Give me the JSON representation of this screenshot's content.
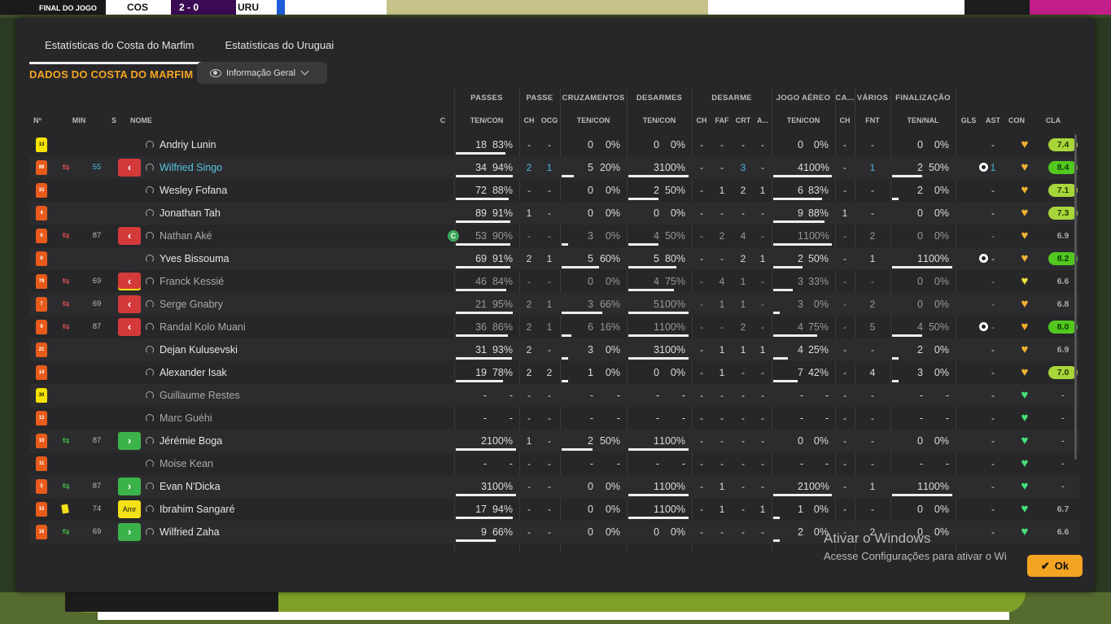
{
  "background": {
    "final_label": "FINAL DO JOGO",
    "team_a": "COS",
    "score": "2 - 0",
    "team_b": "URU"
  },
  "tabs": [
    {
      "label": "Estatísticas do Costa do Marfim",
      "active": true
    },
    {
      "label": "Estatísticas do Uruguai",
      "active": false
    }
  ],
  "section_title": "DADOS DO COSTA DO MARFIM",
  "view_dropdown": {
    "label": "Informação Geral"
  },
  "group_headers": [
    "PASSES",
    "PASSE",
    "CRUZAMENTOS",
    "DESARMES",
    "DESARME",
    "JOGO AÉREO",
    "CA...",
    "VÁRIOS",
    "FINALIZAÇÃO"
  ],
  "columns": {
    "no": "Nº",
    "min": "MIN",
    "s": "S",
    "name": "NOME",
    "c": "C",
    "passes": "TEN/CON",
    "passe_ch": "CH",
    "passe_ocg": "OCG",
    "cruz": "TEN/CON",
    "des": "TEN/CON",
    "d_ch": "CH",
    "d_faf": "FAF",
    "d_crt": "CRT",
    "d_a": "A...",
    "aereo": "TEN/CON",
    "ca_ch": "CH",
    "fnt": "FNT",
    "fin": "TEN/NAL",
    "gls": "GLS",
    "ast": "AST",
    "con": "CON",
    "cla": "CLA"
  },
  "players": [
    {
      "no": "13",
      "gk": true,
      "min": "",
      "sub": "",
      "s": "",
      "name": "Andriy Lunin",
      "style": "",
      "cap": false,
      "pas": [
        "18",
        "83%"
      ],
      "pas_pct": 83,
      "pch": "-",
      "pocg": "-",
      "cru": [
        "0",
        "0%"
      ],
      "cru_pct": 0,
      "des": [
        "0",
        "0%"
      ],
      "des_pct": 0,
      "dch": "-",
      "faf": "-",
      "crt": "-",
      "da": "-",
      "aer": [
        "0",
        "0%"
      ],
      "aer_pct": 0,
      "cach": "-",
      "fnt": "-",
      "fin": [
        "0",
        "0%"
      ],
      "fin_pct": 0,
      "gls": "",
      "ast": "-",
      "rating": "7.4",
      "rclass": "mid",
      "dimnums": false
    },
    {
      "no": "99",
      "gk": false,
      "min": "55",
      "sub": "out",
      "s": "out",
      "name": "Wilfried Singo",
      "style": "blue",
      "cap": false,
      "pas": [
        "34",
        "94%"
      ],
      "pas_pct": 94,
      "pch": "2",
      "pocg": "1",
      "cru": [
        "5",
        "20%"
      ],
      "cru_pct": 20,
      "des": [
        "3",
        "100%"
      ],
      "des_pct": 100,
      "dch": "-",
      "faf": "-",
      "crt": "3",
      "da": "-",
      "aer": [
        "4",
        "100%"
      ],
      "aer_pct": 100,
      "cach": "-",
      "fnt": "1",
      "fin": [
        "2",
        "50%"
      ],
      "fin_pct": 50,
      "gls": "ball",
      "ast": "1",
      "rating": "8.4",
      "rclass": "hi",
      "dimnums": false,
      "blue": true
    },
    {
      "no": "33",
      "gk": false,
      "min": "",
      "sub": "",
      "s": "",
      "name": "Wesley Fofana",
      "style": "",
      "cap": false,
      "pas": [
        "72",
        "88%"
      ],
      "pas_pct": 88,
      "pch": "-",
      "pocg": "-",
      "cru": [
        "0",
        "0%"
      ],
      "cru_pct": 0,
      "des": [
        "2",
        "50%"
      ],
      "des_pct": 50,
      "dch": "-",
      "faf": "1",
      "crt": "2",
      "da": "1",
      "aer": [
        "6",
        "83%"
      ],
      "aer_pct": 83,
      "cach": "-",
      "fnt": "-",
      "fin": [
        "2",
        "0%"
      ],
      "fin_pct": 0,
      "gls": "",
      "ast": "-",
      "rating": "7.1",
      "rclass": "mid",
      "dimnums": false
    },
    {
      "no": "4",
      "gk": false,
      "min": "",
      "sub": "",
      "s": "",
      "name": "Jonathan Tah",
      "style": "",
      "cap": false,
      "pas": [
        "89",
        "91%"
      ],
      "pas_pct": 91,
      "pch": "1",
      "pocg": "-",
      "cru": [
        "0",
        "0%"
      ],
      "cru_pct": 0,
      "des": [
        "0",
        "0%"
      ],
      "des_pct": 0,
      "dch": "-",
      "faf": "-",
      "crt": "-",
      "da": "-",
      "aer": [
        "9",
        "88%"
      ],
      "aer_pct": 88,
      "cach": "1",
      "fnt": "-",
      "fin": [
        "0",
        "0%"
      ],
      "fin_pct": 0,
      "gls": "",
      "ast": "-",
      "rating": "7.3",
      "rclass": "mid",
      "dimnums": false
    },
    {
      "no": "6",
      "gk": false,
      "min": "87",
      "sub": "out",
      "s": "out",
      "name": "Nathan Aké",
      "style": "dim",
      "cap": true,
      "pas": [
        "53",
        "90%"
      ],
      "pas_pct": 90,
      "pch": "-",
      "pocg": "-",
      "cru": [
        "3",
        "0%"
      ],
      "cru_pct": 0,
      "des": [
        "4",
        "50%"
      ],
      "des_pct": 50,
      "dch": "-",
      "faf": "2",
      "crt": "4",
      "da": "-",
      "aer": [
        "1",
        "100%"
      ],
      "aer_pct": 100,
      "cach": "-",
      "fnt": "2",
      "fin": [
        "0",
        "0%"
      ],
      "fin_pct": 0,
      "gls": "",
      "ast": "-",
      "rating": "6.9",
      "rclass": "plain",
      "dimnums": true
    },
    {
      "no": "8",
      "gk": false,
      "min": "",
      "sub": "",
      "s": "",
      "name": "Yves Bissouma",
      "style": "",
      "cap": false,
      "pas": [
        "69",
        "91%"
      ],
      "pas_pct": 91,
      "pch": "2",
      "pocg": "1",
      "cru": [
        "5",
        "60%"
      ],
      "cru_pct": 60,
      "des": [
        "5",
        "80%"
      ],
      "des_pct": 80,
      "dch": "-",
      "faf": "-",
      "crt": "2",
      "da": "1",
      "aer": [
        "2",
        "50%"
      ],
      "aer_pct": 50,
      "cach": "-",
      "fnt": "1",
      "fin": [
        "1",
        "100%"
      ],
      "fin_pct": 100,
      "gls": "ball",
      "ast": "-",
      "rating": "8.2",
      "rclass": "hi",
      "dimnums": false
    },
    {
      "no": "79",
      "gk": false,
      "min": "69",
      "sub": "out",
      "s": "out-y",
      "name": "Franck Kessié",
      "style": "dim",
      "cap": false,
      "pas": [
        "46",
        "84%"
      ],
      "pas_pct": 84,
      "pch": "-",
      "pocg": "-",
      "cru": [
        "0",
        "0%"
      ],
      "cru_pct": 0,
      "des": [
        "4",
        "75%"
      ],
      "des_pct": 75,
      "dch": "-",
      "faf": "4",
      "crt": "1",
      "da": "-",
      "aer": [
        "3",
        "33%"
      ],
      "aer_pct": 33,
      "cach": "-",
      "fnt": "-",
      "fin": [
        "0",
        "0%"
      ],
      "fin_pct": 0,
      "gls": "",
      "ast": "-",
      "rating": "6.6",
      "rclass": "plain",
      "dimnums": true,
      "heart": "yellow"
    },
    {
      "no": "7",
      "gk": false,
      "min": "69",
      "sub": "out",
      "s": "out",
      "name": "Serge Gnabry",
      "style": "dim",
      "cap": false,
      "pas": [
        "21",
        "95%"
      ],
      "pas_pct": 95,
      "pch": "2",
      "pocg": "1",
      "cru": [
        "3",
        "66%"
      ],
      "cru_pct": 66,
      "des": [
        "5",
        "100%"
      ],
      "des_pct": 100,
      "dch": "-",
      "faf": "1",
      "crt": "1",
      "da": "-",
      "aer": [
        "3",
        "0%"
      ],
      "aer_pct": 0,
      "cach": "-",
      "fnt": "2",
      "fin": [
        "0",
        "0%"
      ],
      "fin_pct": 0,
      "gls": "",
      "ast": "-",
      "rating": "6.8",
      "rclass": "plain",
      "dimnums": true
    },
    {
      "no": "9",
      "gk": false,
      "min": "87",
      "sub": "out",
      "s": "out",
      "name": "Randal Kolo Muani",
      "style": "dim",
      "cap": false,
      "pas": [
        "36",
        "86%"
      ],
      "pas_pct": 86,
      "pch": "2",
      "pocg": "1",
      "cru": [
        "6",
        "16%"
      ],
      "cru_pct": 16,
      "des": [
        "1",
        "100%"
      ],
      "des_pct": 100,
      "dch": "-",
      "faf": "-",
      "crt": "2",
      "da": "-",
      "aer": [
        "4",
        "75%"
      ],
      "aer_pct": 75,
      "cach": "-",
      "fnt": "5",
      "fin": [
        "4",
        "50%"
      ],
      "fin_pct": 50,
      "gls": "ball",
      "ast": "-",
      "rating": "8.0",
      "rclass": "hi",
      "dimnums": true
    },
    {
      "no": "21",
      "gk": false,
      "min": "",
      "sub": "",
      "s": "",
      "name": "Dejan Kulusevski",
      "style": "",
      "cap": false,
      "pas": [
        "31",
        "93%"
      ],
      "pas_pct": 93,
      "pch": "2",
      "pocg": "-",
      "cru": [
        "3",
        "0%"
      ],
      "cru_pct": 0,
      "des": [
        "3",
        "100%"
      ],
      "des_pct": 100,
      "dch": "-",
      "faf": "1",
      "crt": "1",
      "da": "1",
      "aer": [
        "4",
        "25%"
      ],
      "aer_pct": 25,
      "cach": "-",
      "fnt": "-",
      "fin": [
        "2",
        "0%"
      ],
      "fin_pct": 0,
      "gls": "",
      "ast": "-",
      "rating": "6.9",
      "rclass": "plain",
      "dimnums": false
    },
    {
      "no": "14",
      "gk": false,
      "min": "",
      "sub": "",
      "s": "",
      "name": "Alexander Isak",
      "style": "",
      "cap": false,
      "pas": [
        "19",
        "78%"
      ],
      "pas_pct": 78,
      "pch": "2",
      "pocg": "2",
      "cru": [
        "1",
        "0%"
      ],
      "cru_pct": 0,
      "des": [
        "0",
        "0%"
      ],
      "des_pct": 0,
      "dch": "-",
      "faf": "1",
      "crt": "-",
      "da": "-",
      "aer": [
        "7",
        "42%"
      ],
      "aer_pct": 42,
      "cach": "-",
      "fnt": "4",
      "fin": [
        "3",
        "0%"
      ],
      "fin_pct": 0,
      "gls": "",
      "ast": "-",
      "rating": "7.0",
      "rclass": "mid",
      "dimnums": false
    },
    {
      "no": "30",
      "gk": true,
      "min": "",
      "sub": "",
      "s": "",
      "name": "Guillaume Restes",
      "style": "dim",
      "cap": false,
      "pas": [
        "-",
        "-"
      ],
      "pas_pct": 0,
      "pch": "-",
      "pocg": "-",
      "cru": [
        "-",
        "-"
      ],
      "cru_pct": 0,
      "des": [
        "-",
        "-"
      ],
      "des_pct": 0,
      "dch": "-",
      "faf": "-",
      "crt": "-",
      "da": "-",
      "aer": [
        "-",
        "-"
      ],
      "aer_pct": 0,
      "cach": "-",
      "fnt": "-",
      "fin": [
        "-",
        "-"
      ],
      "fin_pct": 0,
      "gls": "",
      "ast": "-",
      "rating": "-",
      "rclass": "plain",
      "dimnums": false,
      "heart": "green"
    },
    {
      "no": "12",
      "gk": false,
      "min": "",
      "sub": "",
      "s": "",
      "name": "Marc Guéhi",
      "style": "dim",
      "cap": false,
      "pas": [
        "-",
        "-"
      ],
      "pas_pct": 0,
      "pch": "-",
      "pocg": "-",
      "cru": [
        "-",
        "-"
      ],
      "cru_pct": 0,
      "des": [
        "-",
        "-"
      ],
      "des_pct": 0,
      "dch": "-",
      "faf": "-",
      "crt": "-",
      "da": "-",
      "aer": [
        "-",
        "-"
      ],
      "aer_pct": 0,
      "cach": "-",
      "fnt": "-",
      "fin": [
        "-",
        "-"
      ],
      "fin_pct": 0,
      "gls": "",
      "ast": "-",
      "rating": "-",
      "rclass": "plain",
      "dimnums": false,
      "heart": "green"
    },
    {
      "no": "10",
      "gk": false,
      "min": "87",
      "sub": "in",
      "s": "in",
      "name": "Jérémie Boga",
      "style": "",
      "cap": false,
      "pas": [
        "2",
        "100%"
      ],
      "pas_pct": 100,
      "pch": "1",
      "pocg": "-",
      "cru": [
        "2",
        "50%"
      ],
      "cru_pct": 50,
      "des": [
        "1",
        "100%"
      ],
      "des_pct": 100,
      "dch": "-",
      "faf": "-",
      "crt": "-",
      "da": "-",
      "aer": [
        "0",
        "0%"
      ],
      "aer_pct": 0,
      "cach": "-",
      "fnt": "-",
      "fin": [
        "0",
        "0%"
      ],
      "fin_pct": 0,
      "gls": "",
      "ast": "-",
      "rating": "-",
      "rclass": "plain",
      "dimnums": false,
      "heart": "green"
    },
    {
      "no": "11",
      "gk": false,
      "min": "",
      "sub": "",
      "s": "",
      "name": "Moise Kean",
      "style": "dim",
      "cap": false,
      "pas": [
        "-",
        "-"
      ],
      "pas_pct": 0,
      "pch": "-",
      "pocg": "-",
      "cru": [
        "-",
        "-"
      ],
      "cru_pct": 0,
      "des": [
        "-",
        "-"
      ],
      "des_pct": 0,
      "dch": "-",
      "faf": "-",
      "crt": "-",
      "da": "-",
      "aer": [
        "-",
        "-"
      ],
      "aer_pct": 0,
      "cach": "-",
      "fnt": "-",
      "fin": [
        "-",
        "-"
      ],
      "fin_pct": 0,
      "gls": "",
      "ast": "-",
      "rating": "-",
      "rclass": "plain",
      "dimnums": false,
      "heart": "green"
    },
    {
      "no": "5",
      "gk": false,
      "min": "87",
      "sub": "in",
      "s": "in",
      "name": "Evan N'Dicka",
      "style": "",
      "cap": false,
      "pas": [
        "3",
        "100%"
      ],
      "pas_pct": 100,
      "pch": "-",
      "pocg": "-",
      "cru": [
        "0",
        "0%"
      ],
      "cru_pct": 0,
      "des": [
        "1",
        "100%"
      ],
      "des_pct": 100,
      "dch": "-",
      "faf": "1",
      "crt": "-",
      "da": "-",
      "aer": [
        "2",
        "100%"
      ],
      "aer_pct": 100,
      "cach": "-",
      "fnt": "1",
      "fin": [
        "1",
        "100%"
      ],
      "fin_pct": 100,
      "gls": "",
      "ast": "-",
      "rating": "-",
      "rclass": "plain",
      "dimnums": false,
      "heart": "green"
    },
    {
      "no": "15",
      "gk": false,
      "min": "74",
      "sub": "yc",
      "s": "amr",
      "name": "Ibrahim Sangaré",
      "style": "",
      "cap": false,
      "pas": [
        "17",
        "94%"
      ],
      "pas_pct": 94,
      "pch": "-",
      "pocg": "-",
      "cru": [
        "0",
        "0%"
      ],
      "cru_pct": 0,
      "des": [
        "1",
        "100%"
      ],
      "des_pct": 100,
      "dch": "-",
      "faf": "1",
      "crt": "-",
      "da": "1",
      "aer": [
        "1",
        "0%"
      ],
      "aer_pct": 0,
      "cach": "-",
      "fnt": "-",
      "fin": [
        "0",
        "0%"
      ],
      "fin_pct": 0,
      "gls": "",
      "ast": "-",
      "rating": "6.7",
      "rclass": "plain",
      "dimnums": false,
      "heart": "green"
    },
    {
      "no": "16",
      "gk": false,
      "min": "69",
      "sub": "in",
      "s": "in",
      "name": "Wilfried Zaha",
      "style": "",
      "cap": false,
      "pas": [
        "9",
        "66%"
      ],
      "pas_pct": 66,
      "pch": "-",
      "pocg": "-",
      "cru": [
        "0",
        "0%"
      ],
      "cru_pct": 0,
      "des": [
        "0",
        "0%"
      ],
      "des_pct": 0,
      "dch": "-",
      "faf": "-",
      "crt": "-",
      "da": "-",
      "aer": [
        "2",
        "0%"
      ],
      "aer_pct": 0,
      "cach": "-",
      "fnt": "2",
      "fin": [
        "0",
        "0%"
      ],
      "fin_pct": 0,
      "gls": "",
      "ast": "-",
      "rating": "6.6",
      "rclass": "plain",
      "dimnums": false,
      "heart": "green"
    }
  ],
  "amr_label": "Amr",
  "captain_badge": "C",
  "ok_label": "Ok",
  "watermark": {
    "line1": "Ativar o Windows",
    "line2": "Acesse Configurações para ativar o Wi"
  }
}
